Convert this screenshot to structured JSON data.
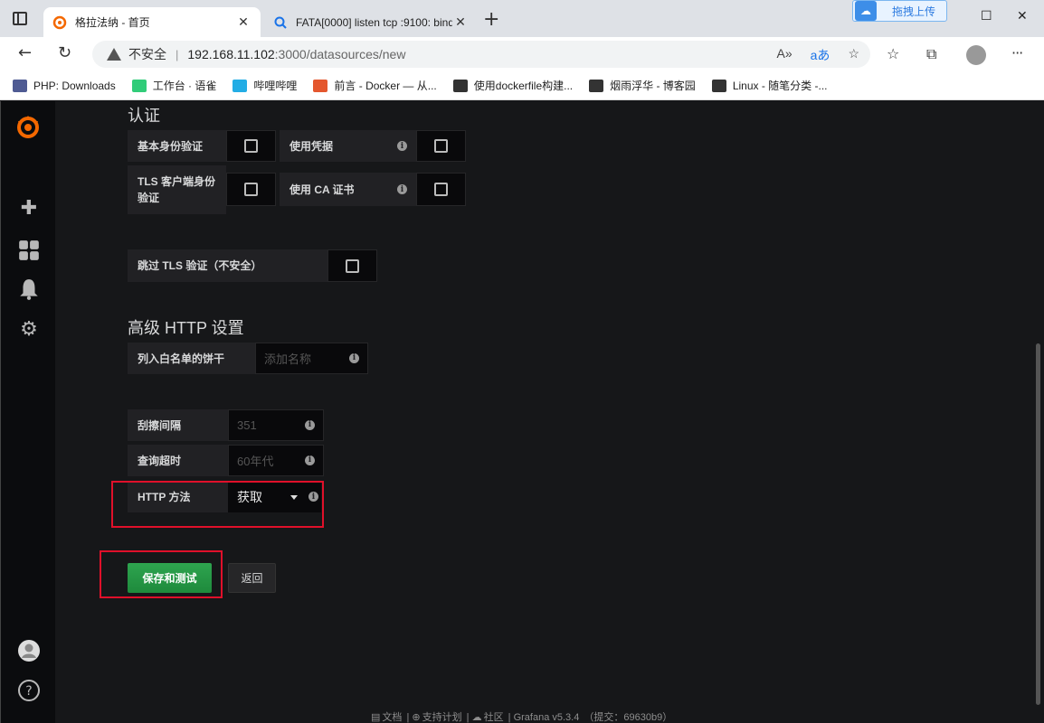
{
  "browser": {
    "tabs": [
      {
        "title": "格拉法纳 - 首页"
      },
      {
        "title": "FATA[0000] listen tcp :9100: bind"
      }
    ],
    "upload_badge": "拖拽上传",
    "address": {
      "security": "不安全",
      "host": "192.168.11.102",
      "path": ":3000/datasources/new"
    },
    "bookmarks": [
      {
        "label": "PHP: Downloads",
        "icon": "php-icon",
        "color": "#4f5b93"
      },
      {
        "label": "工作台 · 语雀",
        "icon": "yuque-icon",
        "color": "#31cc79"
      },
      {
        "label": "哔哩哔哩",
        "icon": "bilibili-icon",
        "color": "#23ade5"
      },
      {
        "label": "前言 - Docker — 从...",
        "icon": "rocket-icon",
        "color": "#e4572e"
      },
      {
        "label": "使用dockerfile构建...",
        "icon": "cnblogs-icon",
        "color": "#333333"
      },
      {
        "label": "烟雨浮华 - 博客园",
        "icon": "cnblogs-icon",
        "color": "#333333"
      },
      {
        "label": "Linux - 随笔分类 -...",
        "icon": "cnblogs-icon",
        "color": "#333333"
      }
    ]
  },
  "auth": {
    "title": "认证",
    "basic_auth": "基本身份验证",
    "with_credentials": "使用凭据",
    "tls_client_auth": "TLS 客户端身份验证",
    "with_ca_cert": "使用 CA 证书",
    "skip_tls": "跳过 TLS 验证（不安全）"
  },
  "advanced": {
    "title": "高级 HTTP 设置",
    "whitelist_label": "列入白名单的饼干",
    "whitelist_placeholder": "添加名称",
    "scrape_label": "刮擦间隔",
    "scrape_placeholder": "351",
    "timeout_label": "查询超时",
    "timeout_placeholder": "60年代",
    "http_method_label": "HTTP 方法",
    "http_method_value": "获取"
  },
  "actions": {
    "save": "保存和测试",
    "back": "返回"
  },
  "footer": {
    "docs": "文档",
    "support": "支持计划",
    "community": "社区",
    "version": "Grafana v5.3.4",
    "commit": "（提交：69630b9）"
  },
  "colors": {
    "grafana_orange": "#f46800",
    "save_green": "#299c46",
    "highlight_red": "#e0102a"
  }
}
